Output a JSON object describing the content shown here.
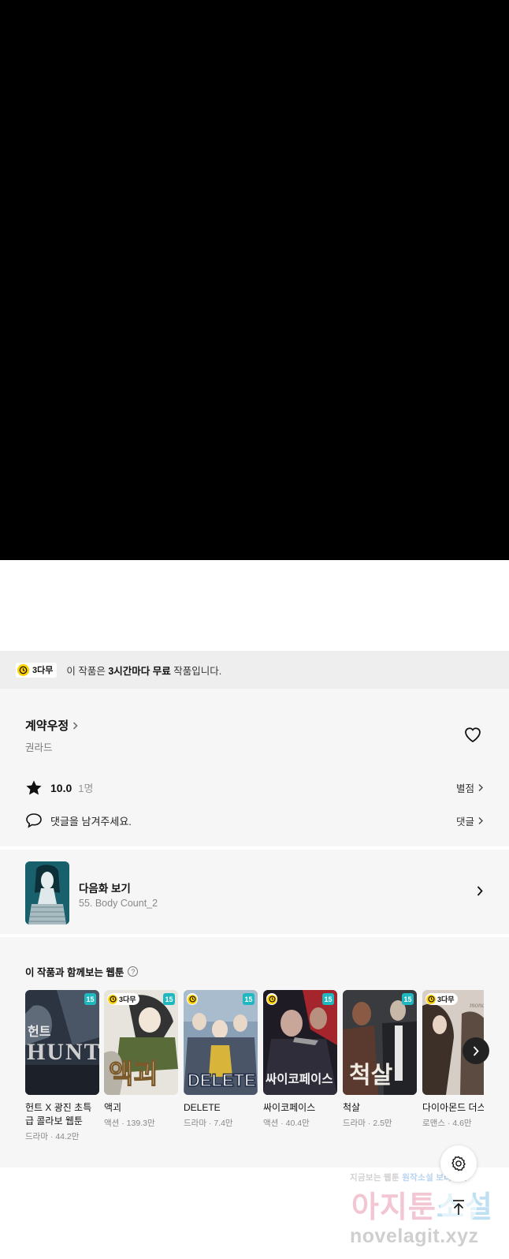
{
  "banner": {
    "badge_label": "3다무",
    "text_prefix": "이 작품은 ",
    "text_bold": "3시간마다 무료",
    "text_suffix": " 작품입니다."
  },
  "episode_info": {
    "title": "계약우정",
    "author": "권라드",
    "rating_value": "10.0",
    "rating_count": "1명",
    "rating_link": "별점",
    "comment_prompt": "댓글을 남겨주세요.",
    "comment_link": "댓글"
  },
  "next_episode": {
    "label": "다음화 보기",
    "subtitle": "55. Body Count_2"
  },
  "recommendations": {
    "heading": "이 작품과 함께보는 웹툰",
    "items": [
      {
        "title": "헌트 X 광진 초특급 콜라보 웹툰",
        "genre": "드라마",
        "views": "44.2만",
        "age": "15",
        "badge": "",
        "cover_text": "헌트 HUNT",
        "cover_color": "#2b3440"
      },
      {
        "title": "액괴",
        "genre": "액션",
        "views": "139.3만",
        "age": "15",
        "badge": "3다무",
        "cover_text": "액괴",
        "cover_color": "#dcdcd4"
      },
      {
        "title": "DELETE",
        "genre": "드라마",
        "views": "7.4만",
        "age": "15",
        "badge": "clock",
        "cover_text": "DELETE",
        "cover_color": "#6a7f96"
      },
      {
        "title": "싸이코페이스",
        "genre": "액션",
        "views": "40.4만",
        "age": "15",
        "badge": "clock",
        "cover_text": "싸이코페이스",
        "cover_color": "#2a2630"
      },
      {
        "title": "척살",
        "genre": "드라마",
        "views": "2.5만",
        "age": "15",
        "badge": "",
        "cover_text": "척살",
        "cover_color": "#3a3b3e"
      },
      {
        "title": "다이아몬드 더스트",
        "genre": "로맨스",
        "views": "4.6만",
        "age": "",
        "badge": "3다무",
        "cover_text": "",
        "cover_color": "#cfc6bd"
      }
    ]
  },
  "watermark": {
    "line1_a": "지금보는 웹툰 ",
    "line1_b": "원작소설 보러가기",
    "big_a": "아지툰",
    "big_b": "소설",
    "url": "novelagit.xyz"
  },
  "colors": {
    "accent_yellow": "#ffd200",
    "age_badge": "#20b8c0"
  }
}
